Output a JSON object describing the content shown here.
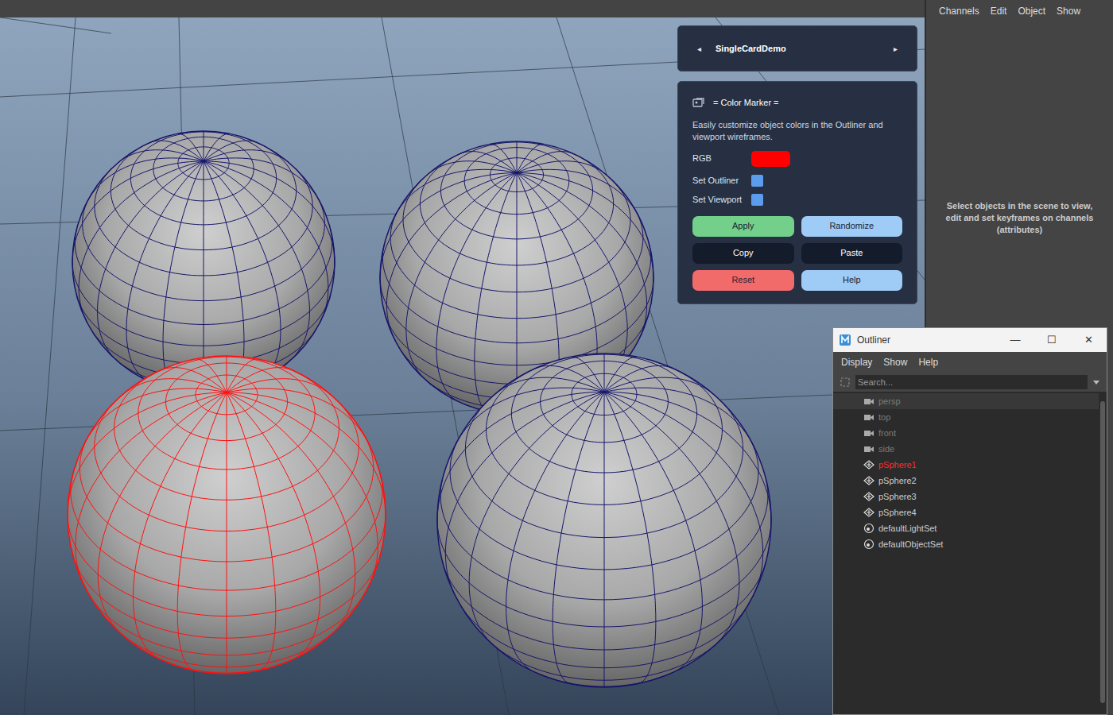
{
  "top_menu": [
    "Channels",
    "Edit",
    "Object",
    "Show"
  ],
  "channel_box": {
    "message": "Select objects in the scene to view, edit and set keyframes on channels (attributes)"
  },
  "viewport": {
    "objects": [
      {
        "color": "#16166a"
      },
      {
        "color": "#16166a"
      },
      {
        "color": "#ff1010"
      },
      {
        "color": "#16166a"
      }
    ]
  },
  "card_nav": {
    "prev": "◂",
    "title": "SingleCardDemo",
    "next": "▸"
  },
  "color_marker": {
    "title": "= Color Marker =",
    "description": "Easily customize object colors in the Outliner and viewport wireframes.",
    "rgb": {
      "label": "RGB",
      "color": "#ff0000"
    },
    "options": [
      {
        "label": "Set Outliner",
        "checked": true
      },
      {
        "label": "Set Viewport",
        "checked": true
      }
    ],
    "buttons": [
      {
        "label": "Apply",
        "color": "#72d08a"
      },
      {
        "label": "Randomize",
        "color": "#9fcbf7"
      },
      {
        "label": "Copy",
        "color": "#141b2b"
      },
      {
        "label": "Paste",
        "color": "#141b2b"
      },
      {
        "label": "Reset",
        "color": "#f26b6b"
      },
      {
        "label": "Help",
        "color": "#9fcbf7"
      }
    ]
  },
  "outliner": {
    "title": "Outliner",
    "controls": [
      "—",
      "☐",
      "✕"
    ],
    "menu": [
      "Display",
      "Show",
      "Help"
    ],
    "search": {
      "placeholder": "Search..."
    },
    "items": [
      {
        "label": "persp",
        "kind": "camera",
        "color": "#7b7b7b",
        "highlighted": true
      },
      {
        "label": "top",
        "kind": "camera",
        "color": "#7b7b7b",
        "highlighted": false
      },
      {
        "label": "front",
        "kind": "camera",
        "color": "#7b7b7b",
        "highlighted": false
      },
      {
        "label": "side",
        "kind": "camera",
        "color": "#7b7b7b",
        "highlighted": false
      },
      {
        "label": "pSphere1",
        "kind": "mesh",
        "color": "#ff2a2a",
        "highlighted": false
      },
      {
        "label": "pSphere2",
        "kind": "mesh",
        "color": "#cccccc",
        "highlighted": false
      },
      {
        "label": "pSphere3",
        "kind": "mesh",
        "color": "#cccccc",
        "highlighted": false
      },
      {
        "label": "pSphere4",
        "kind": "mesh",
        "color": "#cccccc",
        "highlighted": false
      },
      {
        "label": "defaultLightSet",
        "kind": "set",
        "color": "#cccccc",
        "highlighted": false
      },
      {
        "label": "defaultObjectSet",
        "kind": "set",
        "color": "#cccccc",
        "highlighted": false
      }
    ]
  }
}
